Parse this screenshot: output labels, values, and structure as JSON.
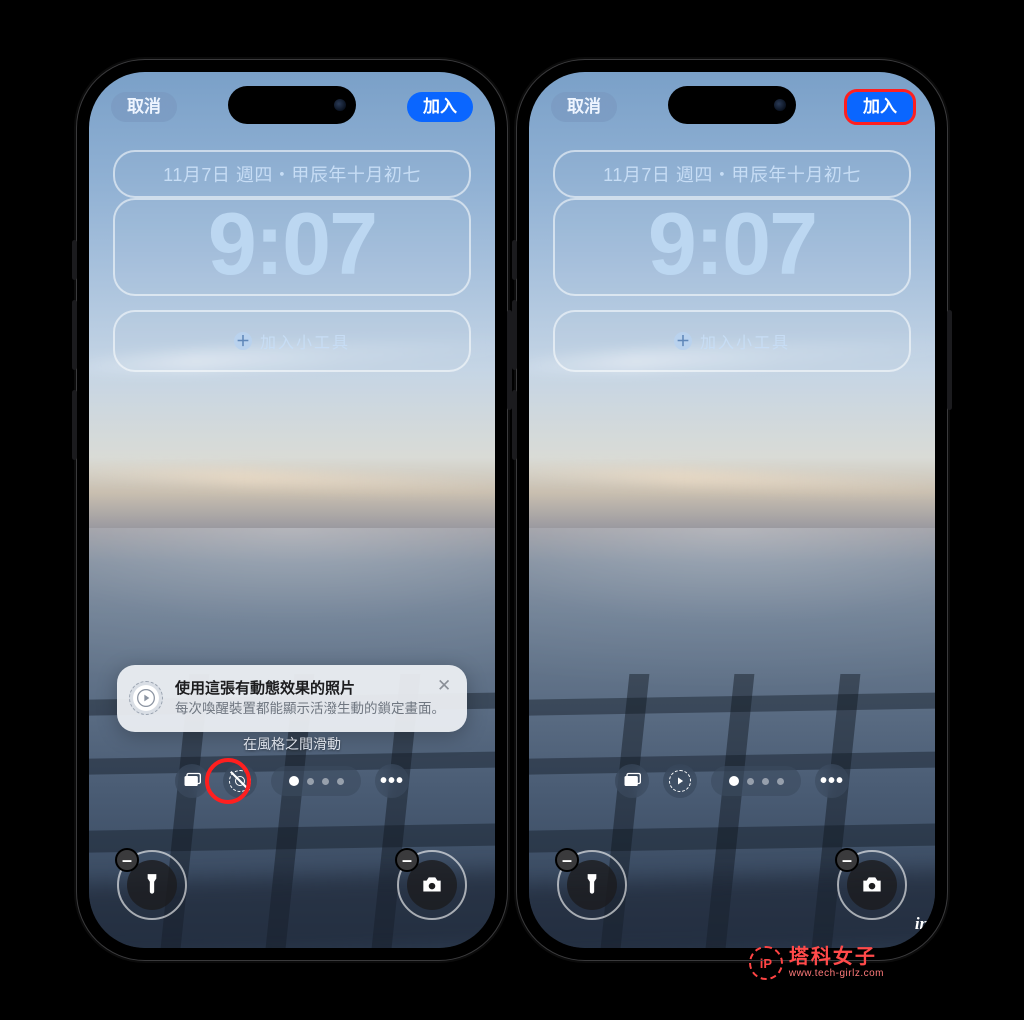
{
  "phone": {
    "cancel_label": "取消",
    "add_label": "加入",
    "date_text": "11月7日 週四・甲辰年十月初七",
    "time_text": "9:07",
    "add_widget_label": "加入小工具",
    "swipe_caption": "在風格之間滑動"
  },
  "hint": {
    "title": "使用這張有動態效果的照片",
    "body": "每次喚醒裝置都能顯示活潑生動的鎖定畫面。"
  },
  "watermark": {
    "brand": "塔科女子",
    "url": "www.tech-girlz.com",
    "bubble": "iP"
  },
  "chart_data": null
}
